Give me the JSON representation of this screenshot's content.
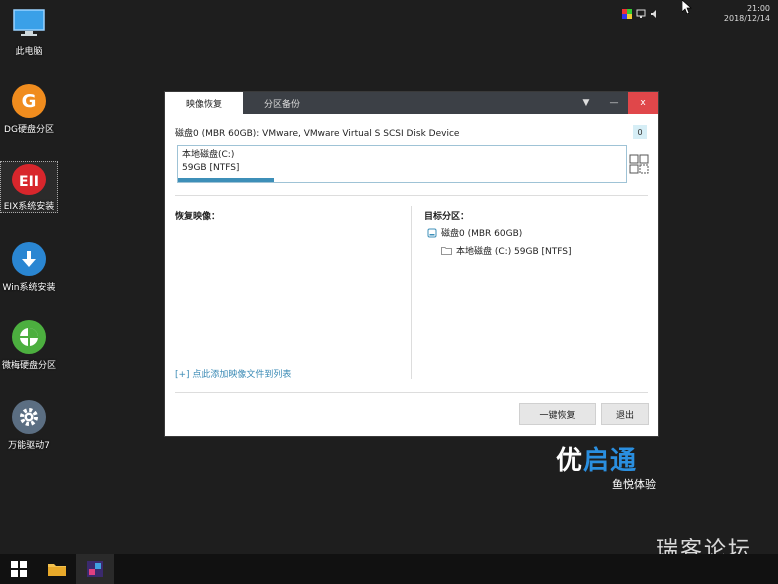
{
  "desktop": {
    "icons": [
      {
        "label": "此电脑"
      },
      {
        "label": "DG硬盘分区"
      },
      {
        "label": "EIX系统安装"
      },
      {
        "label": "Win系统安装"
      },
      {
        "label": "微梅硬盘分区"
      },
      {
        "label": "万能驱动7"
      }
    ]
  },
  "window": {
    "tabs": [
      {
        "label": "映像恢复"
      },
      {
        "label": "分区备份"
      }
    ],
    "controls": {
      "menu": "▼",
      "minimize": "—",
      "close": "x"
    },
    "disk_info": "磁盘0 (MBR 60GB): VMware, VMware Virtual S SCSI Disk Device",
    "disk_badge": "0",
    "partition": {
      "name": "本地磁盘(C:)",
      "size": "59GB [NTFS]",
      "fill_fraction": 0.215
    },
    "restore_label": "恢复映像：",
    "target_label": "目标分区：",
    "target_disk": "磁盘0 (MBR 60GB)",
    "target_partition": "本地磁盘 (C:) 59GB [NTFS]",
    "add_link": "[+] 点此添加映像文件到列表",
    "buttons": {
      "one_click": "一键恢复",
      "exit": "退出"
    }
  },
  "brand": {
    "logo_a": "优",
    "logo_b": "启通",
    "sub": "鱼悦体验"
  },
  "tray": {
    "time": "21:00",
    "date": "2018/12/14"
  },
  "watermark": "瑞客论坛",
  "colors": {
    "accent": "#3d8fb8",
    "close": "#e0474a",
    "titlebar": "#3c4046"
  }
}
